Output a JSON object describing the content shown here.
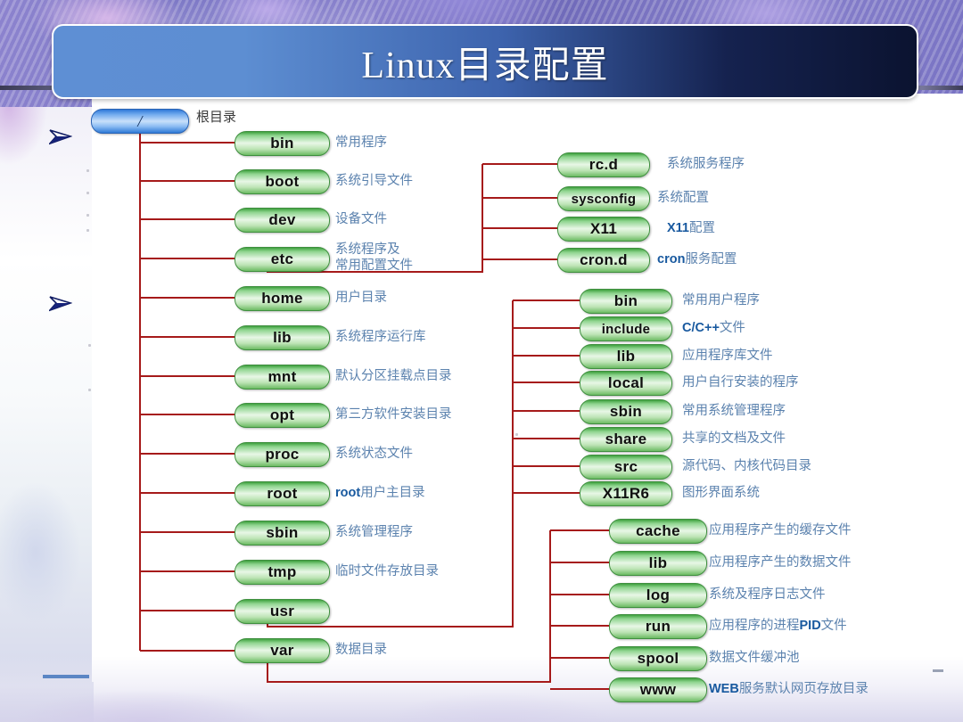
{
  "slide": {
    "title": "Linux目录配置",
    "decor": {
      "banner_gradient_start": "#5e8fd4",
      "banner_gradient_end": "#0b1330",
      "node_green": "#8fd48f",
      "node_blue": "#6fa9ee",
      "wire_color": "#a61a1a",
      "label_color": "#5b82ae",
      "label_accent_color": "#18599f"
    }
  },
  "tree": {
    "root": {
      "name": "/",
      "label": "根目录"
    },
    "level1": [
      {
        "name": "bin",
        "label": "常用程序"
      },
      {
        "name": "boot",
        "label": "系统引导文件"
      },
      {
        "name": "dev",
        "label": "设备文件"
      },
      {
        "name": "etc",
        "label": "系统程序及",
        "label2": "常用配置文件"
      },
      {
        "name": "home",
        "label": "用户目录"
      },
      {
        "name": "lib",
        "label": "系统程序运行库"
      },
      {
        "name": "mnt",
        "label": "默认分区挂载点目录"
      },
      {
        "name": "opt",
        "label": "第三方软件安装目录"
      },
      {
        "name": "proc",
        "label": "系统状态文件"
      },
      {
        "name": "root",
        "label_bold": "root",
        "label": "用户主目录"
      },
      {
        "name": "sbin",
        "label": "系统管理程序"
      },
      {
        "name": "tmp",
        "label": "临时文件存放目录"
      },
      {
        "name": "usr",
        "label": ""
      },
      {
        "name": "var",
        "label": "数据目录"
      }
    ],
    "etc_children": [
      {
        "name": "rc.d",
        "label": "系统服务程序"
      },
      {
        "name": "sysconfig",
        "label": "系统配置"
      },
      {
        "name": "X11",
        "label_bold": "X11",
        "label": "配置"
      },
      {
        "name": "cron.d",
        "label_bold": "cron",
        "label": "服务配置"
      }
    ],
    "usr_children": [
      {
        "name": "bin",
        "label": "常用用户程序"
      },
      {
        "name": "include",
        "label_bold": "C/C++",
        "label": "文件"
      },
      {
        "name": "lib",
        "label": "应用程序库文件"
      },
      {
        "name": "local",
        "label": "用户自行安装的程序"
      },
      {
        "name": "sbin",
        "label": "常用系统管理程序"
      },
      {
        "name": "share",
        "label": "共享的文档及文件"
      },
      {
        "name": "src",
        "label": "源代码、内核代码目录"
      },
      {
        "name": "X11R6",
        "label": "图形界面系统"
      }
    ],
    "var_children": [
      {
        "name": "cache",
        "label": "应用程序产生的缓存文件"
      },
      {
        "name": "lib",
        "label": "应用程序产生的数据文件"
      },
      {
        "name": "log",
        "label": "系统及程序日志文件"
      },
      {
        "name": "run",
        "label": "应用程序的进程",
        "label_bold_mid": "PID",
        "label_tail": "文件"
      },
      {
        "name": "spool",
        "label": "数据文件缓冲池"
      },
      {
        "name": "www",
        "label_bold": "WEB",
        "label": "服务默认网页存放目录"
      }
    ]
  }
}
